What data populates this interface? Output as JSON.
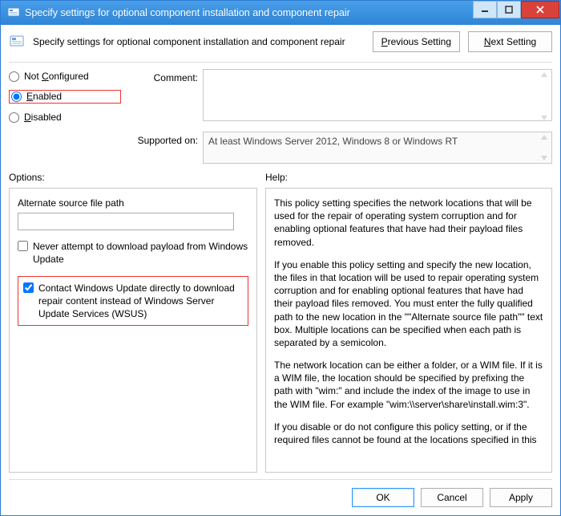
{
  "window": {
    "title": "Specify settings for optional component installation and component repair"
  },
  "header": {
    "description": "Specify settings for optional component installation and component repair",
    "prev_button": "Previous Setting",
    "prev_accel": "P",
    "next_button": "Next Setting",
    "next_accel": "N"
  },
  "state": {
    "not_configured_label": "Not Configured",
    "not_configured_accel": "C",
    "enabled_label": "Enabled",
    "enabled_accel": "E",
    "disabled_label": "Disabled",
    "disabled_accel": "D",
    "selected": "enabled"
  },
  "comment": {
    "label": "Comment:",
    "value": ""
  },
  "supported": {
    "label": "Supported on:",
    "value": "At least Windows Server 2012, Windows 8 or Windows RT"
  },
  "options": {
    "header": "Options:",
    "alt_path_label": "Alternate source file path",
    "alt_path_value": "",
    "never_download_label": "Never attempt to download payload from Windows Update",
    "never_download_checked": false,
    "wsus_label": "Contact Windows Update directly to download repair content instead of Windows Server Update Services (WSUS)",
    "wsus_checked": true
  },
  "help": {
    "header": "Help:",
    "paragraphs": [
      "This policy setting specifies the network locations that will be used for the repair of operating system corruption and for enabling optional features that have had their payload files removed.",
      "If you enable this policy setting and specify the new location, the files in that location will be used to repair operating system corruption and for enabling optional features that have had their payload files removed. You must enter the fully qualified path to the new location in the \"\"Alternate source file path\"\" text box. Multiple locations can be specified when each path is separated by a semicolon.",
      "The network location can be either a folder, or a WIM file. If it is a WIM file, the location should be specified by prefixing the path with \"wim:\" and include the index of the image to use in the WIM file. For example \"wim:\\\\server\\share\\install.wim:3\".",
      "If you disable or do not configure this policy setting, or if the required files cannot be found at the locations specified in this"
    ]
  },
  "footer": {
    "ok": "OK",
    "cancel": "Cancel",
    "apply": "Apply"
  }
}
